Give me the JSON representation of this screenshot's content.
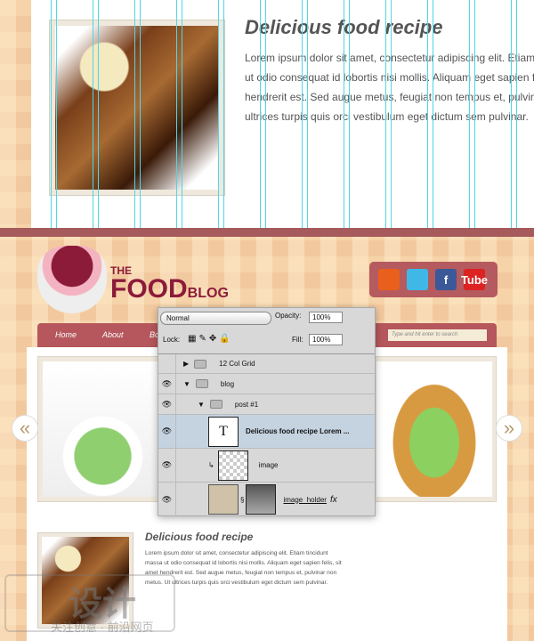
{
  "top_post": {
    "title": "Delicious food recipe",
    "text": "Lorem ipsum dolor sit amet, consectetur adipiscing elit. Etiam tincidunt massa ut odio consequat id lobortis nisi mollis. Aliquam eget sapien felis, sit amet hendrerit est. Sed augue metus, feugiat non tempus et, pulvinar non metus. Ut ultrices turpis quis orci vestibulum eget dictum sem pulvinar."
  },
  "logo": {
    "the": "THE",
    "food": "FOOD",
    "blog": "BLOG"
  },
  "social": [
    {
      "name": "rss-icon",
      "label": "",
      "color": "#e8601c"
    },
    {
      "name": "twitter-icon",
      "label": "",
      "color": "#3fb8e8"
    },
    {
      "name": "facebook-icon",
      "label": "f",
      "color": "#3b5998"
    },
    {
      "name": "youtube-icon",
      "label": "Tube",
      "color": "#d22"
    }
  ],
  "nav": {
    "items": [
      "Home",
      "About",
      "Bo"
    ],
    "search_placeholder": "Type and hit enter to search"
  },
  "slider": {
    "prev": "«",
    "next": "»"
  },
  "layers_panel": {
    "blend_mode": "Normal",
    "opacity_label": "Opacity:",
    "opacity": "100%",
    "lock_label": "Lock:",
    "fill_label": "Fill:",
    "fill": "100%",
    "layers": [
      "12 Col Grid",
      "blog",
      "post #1",
      "Delicious food recipe Lorem ...",
      "image",
      "image_holder"
    ],
    "text_thumb": "T",
    "fx": "fx"
  },
  "post": {
    "title": "Delicious food recipe",
    "text": "Lorem ipsum dolor sit amet, consectetur adipiscing elit. Etiam tincidunt massa ut odio consequat id lobortis nisi mollis. Aliquam eget sapien felis, sit amet hendrerit est. Sed augue metus, feugiat non tempus et, pulvinar non metus. Ut ultrices turpis quis orci vestibulum eget dictum sem pulvinar."
  },
  "watermark": {
    "big": "设计",
    "small": "关注创意 · 前沿网页"
  }
}
